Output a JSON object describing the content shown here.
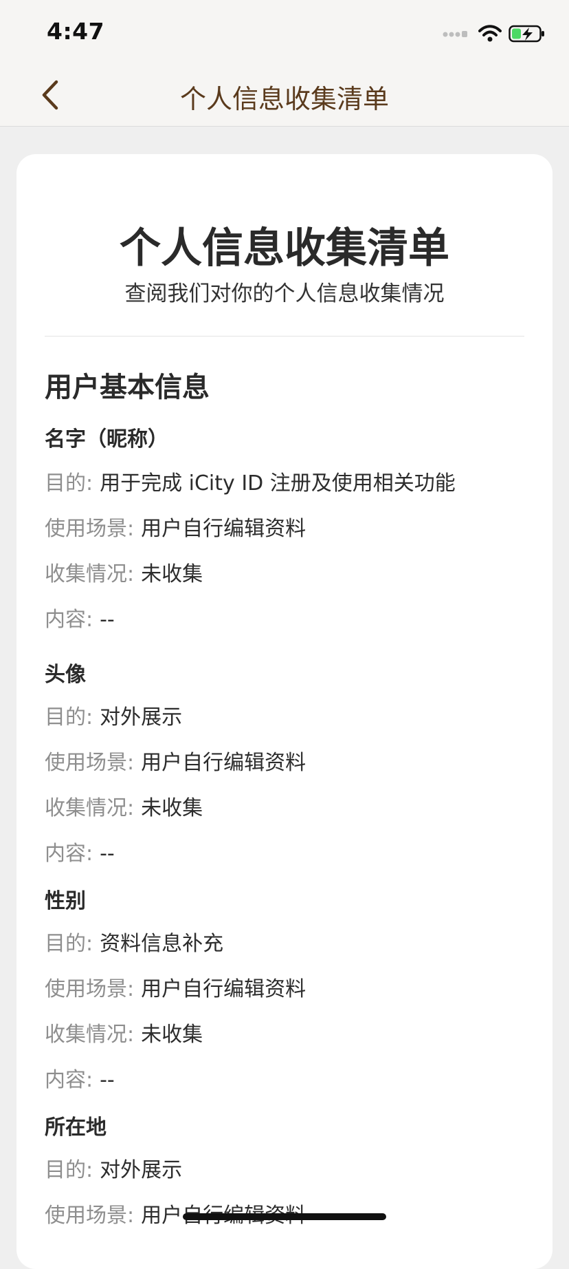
{
  "status_bar": {
    "time": "4:47",
    "icons": [
      "signal-dots-icon",
      "wifi-icon",
      "battery-charging-icon"
    ],
    "battery_color": "#4cd964"
  },
  "nav": {
    "back_icon": "chevron-left-icon",
    "title": "个人信息收集清单",
    "accent_color": "#5a3a1c"
  },
  "card": {
    "title": "个人信息收集清单",
    "subtitle": "查阅我们对你的个人信息收集情况"
  },
  "section": {
    "title": "用户基本信息"
  },
  "items": [
    {
      "name": "名字（昵称）",
      "purpose_label": "目的:",
      "purpose": "用于完成 iCity ID 注册及使用相关功能",
      "scene_label": "使用场景:",
      "scene": "用户自行编辑资料",
      "status_label": "收集情况:",
      "status": "未收集",
      "content_label": "内容:",
      "content": "--"
    },
    {
      "name": "头像",
      "purpose_label": "目的:",
      "purpose": "对外展示",
      "scene_label": "使用场景:",
      "scene": "用户自行编辑资料",
      "status_label": "收集情况:",
      "status": "未收集",
      "content_label": "内容:",
      "content": "--"
    },
    {
      "name": "性别",
      "purpose_label": "目的:",
      "purpose": "资料信息补充",
      "scene_label": "使用场景:",
      "scene": "用户自行编辑资料",
      "status_label": "收集情况:",
      "status": "未收集",
      "content_label": "内容:",
      "content": "--"
    },
    {
      "name": "所在地",
      "purpose_label": "目的:",
      "purpose": "对外展示",
      "scene_label": "使用场景:",
      "scene": "用户自行编辑资料"
    }
  ]
}
